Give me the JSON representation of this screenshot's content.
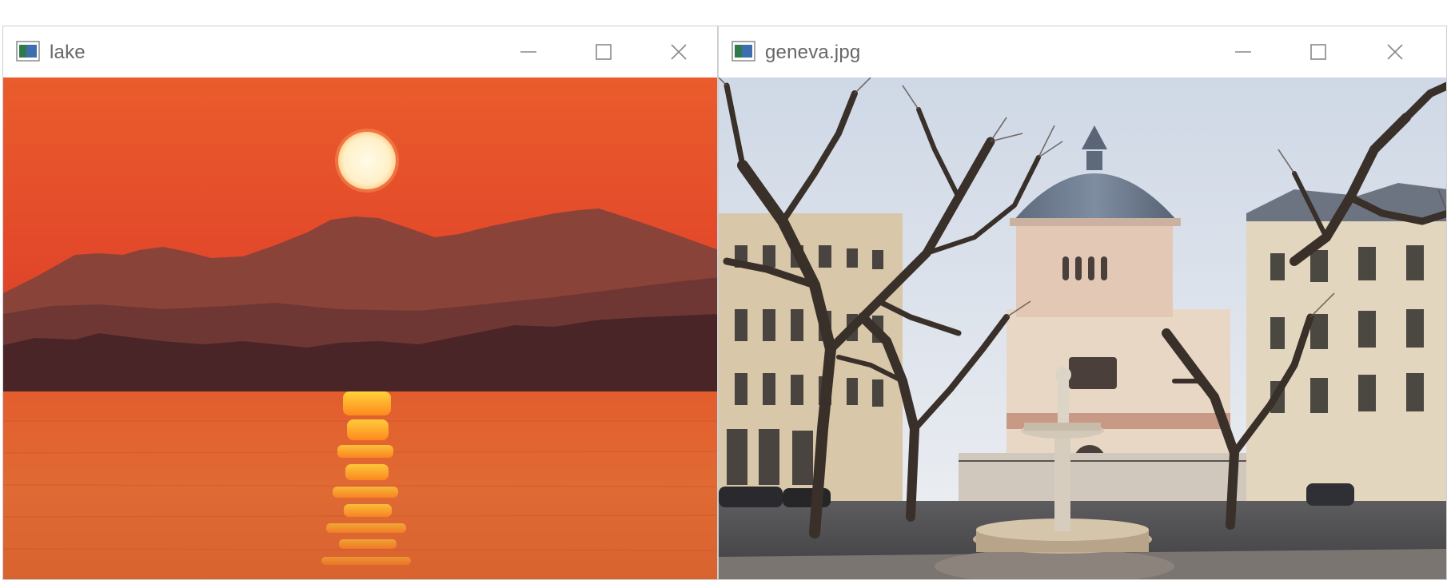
{
  "windows": [
    {
      "title": "lake",
      "icons": {
        "app": "image-window-icon",
        "minimize": "minimize-icon",
        "maximize": "maximize-icon",
        "close": "close-icon"
      }
    },
    {
      "title": "geneva.jpg",
      "icons": {
        "app": "image-window-icon",
        "minimize": "minimize-icon",
        "maximize": "maximize-icon",
        "close": "close-icon"
      }
    }
  ],
  "colors": {
    "sunset_sky": "#e8522a",
    "sun": "#fff6d9",
    "mountains": "#7a3d38",
    "water": "#e0642f",
    "geneva_sky": "#dfe5ee",
    "dome": "#6f7c8f",
    "facade": "#e8d6c6",
    "tree": "#3a302a"
  }
}
